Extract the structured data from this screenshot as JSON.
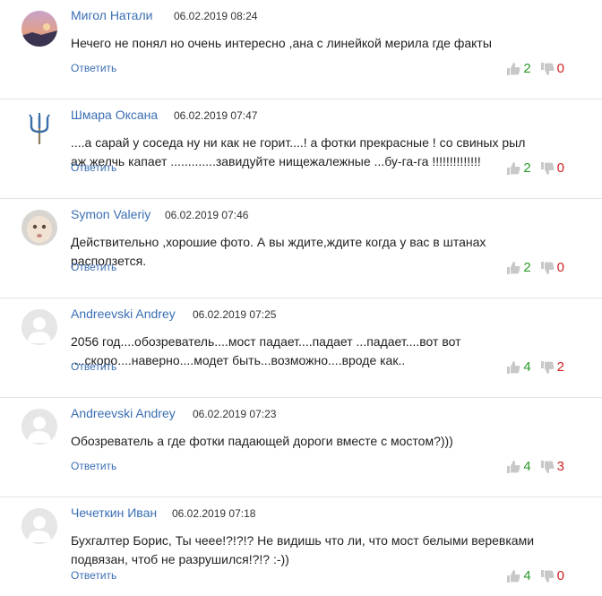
{
  "ui": {
    "reply_label": "Ответить"
  },
  "comments": [
    {
      "author": "Мигол Натали",
      "date": "06.02.2019 08:24",
      "text": "Нечего не понял но очень интересно ,ана с линейкой мерила где факты",
      "likes": "2",
      "dislikes": "0",
      "avatar": "photo-sunset"
    },
    {
      "author": "Шмара Оксана",
      "date": "06.02.2019 07:47",
      "text": "....а сарай у соседа ну ни как не горит....! а фотки прекрасные ! со свиных рыл аж желчь капает .............завидуйте нищежалежные ...бу-га-га !!!!!!!!!!!!!!",
      "likes": "2",
      "dislikes": "0",
      "avatar": "trident"
    },
    {
      "author": "Symon Valeriy",
      "date": "06.02.2019 07:46",
      "text": "Действительно ,хорошие фото. А вы ждите,ждите когда у вас в штанах расползется.",
      "likes": "2",
      "dislikes": "0",
      "avatar": "photo-baby"
    },
    {
      "author": "Andreevski Andrey",
      "date": "06.02.2019 07:25",
      "text": "2056 год....обозреватель....мост падает....падает ...падает....вот вот ....скоро....наверно....модет быть...возможно....вроде как..",
      "likes": "4",
      "dislikes": "2",
      "avatar": "default-user"
    },
    {
      "author": "Andreevski Andrey",
      "date": "06.02.2019 07:23",
      "text": "Обозреватель а где фотки падающей дороги вместе с мостом?)))",
      "likes": "4",
      "dislikes": "3",
      "avatar": "default-user"
    },
    {
      "author": "Чечеткин Иван",
      "date": "06.02.2019 07:18",
      "text": "Бухгалтер Борис, Ты чеее!?!?!? Не видишь что ли, что мост белыми веревками подвязан, чтоб не разрушился!?!? :-))",
      "likes": "4",
      "dislikes": "0",
      "avatar": "default-user"
    }
  ]
}
